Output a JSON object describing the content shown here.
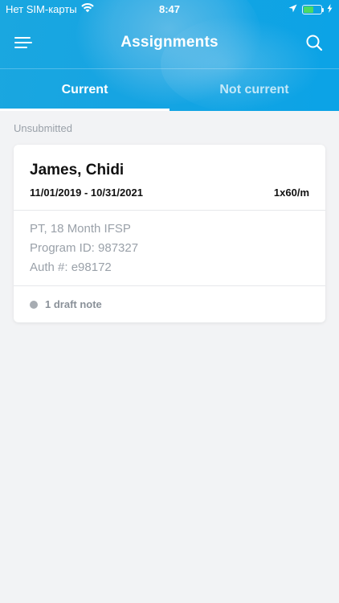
{
  "status_bar": {
    "carrier": "Нет SIM-карты",
    "time": "8:47",
    "battery_level": 0.55
  },
  "nav": {
    "title": "Assignments",
    "menu_icon": "hamburger-menu-icon",
    "search_icon": "search-icon"
  },
  "tabs": [
    {
      "label": "Current",
      "active": true
    },
    {
      "label": "Not current",
      "active": false
    }
  ],
  "section": {
    "label": "Unsubmitted"
  },
  "assignments": [
    {
      "name": "James, Chidi",
      "dates": "11/01/2019 - 10/31/2021",
      "frequency": "1x60/m",
      "service": "PT, 18 Month IFSP",
      "program_id": "Program ID: 987327",
      "auth": "Auth #: e98172",
      "draft_notes": "1 draft note"
    }
  ],
  "colors": {
    "header_blue": "#16a4e2",
    "background": "#f2f3f5",
    "muted_text": "#9aa1a9",
    "battery_green": "#4cd964"
  }
}
